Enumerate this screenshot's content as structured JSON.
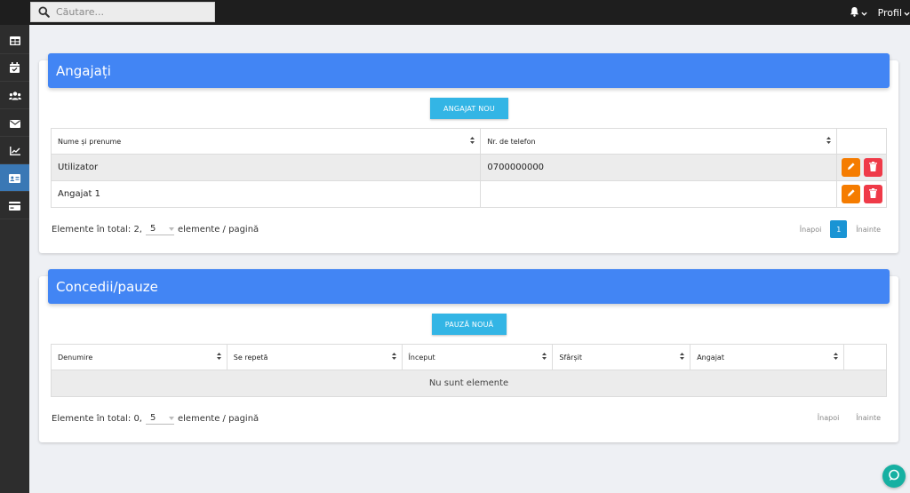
{
  "topbar": {
    "search_placeholder": "Căutare...",
    "profile_label": "Profil"
  },
  "sidebar": {
    "items": [
      {
        "icon": "table-icon"
      },
      {
        "icon": "calendar-check-icon"
      },
      {
        "icon": "users-icon"
      },
      {
        "icon": "envelope-icon"
      },
      {
        "icon": "chart-line-icon"
      },
      {
        "icon": "id-card-icon",
        "active": true
      },
      {
        "icon": "credit-card-icon"
      }
    ]
  },
  "employees": {
    "title": "Angajați",
    "new_button": "ANGAJAT NOU",
    "columns": [
      "Nume și prenume",
      "Nr. de telefon"
    ],
    "rows": [
      {
        "name": "Utilizator",
        "phone": "0700000000"
      },
      {
        "name": "Angajat 1",
        "phone": ""
      }
    ],
    "total_label": "Elemente în total: 2,",
    "per_page_value": "5",
    "per_page_suffix": "elemente / pagină",
    "prev_label": "Înapoi",
    "current_page": "1",
    "next_label": "Înainte"
  },
  "leaves": {
    "title": "Concedii/pauze",
    "new_button": "PAUZĂ NOUĂ",
    "columns": [
      "Denumire",
      "Se repetă",
      "Început",
      "Sfârșit",
      "Angajat"
    ],
    "empty_text": "Nu sunt elemente",
    "total_label": "Elemente în total: 0,",
    "per_page_value": "5",
    "per_page_suffix": "elemente / pagină",
    "prev_label": "Înapoi",
    "next_label": "Înainte"
  },
  "colors": {
    "header_blue": "#4285f4",
    "button_cyan": "#33b5e5",
    "edit_orange": "#f57c00",
    "delete_red": "#ef3a48",
    "page_active": "#1a94d4",
    "chat_teal": "#16b0a2"
  }
}
